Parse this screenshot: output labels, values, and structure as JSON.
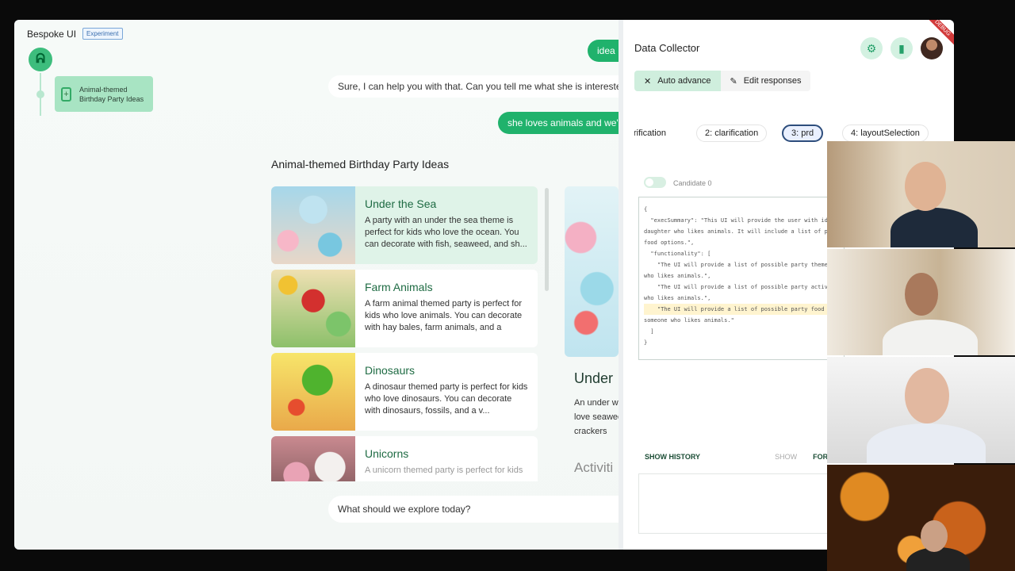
{
  "app": {
    "name": "Bespoke UI",
    "badge": "Experiment"
  },
  "sidebar": {
    "node_label": "Animal-themed Birthday Party Ideas"
  },
  "chat": {
    "user_chip_1": "idea",
    "bot_msg": "Sure, I can help you with that. Can you tell me what she is interested",
    "user_chip_2": "she loves animals and we'"
  },
  "section_title": "Animal-themed Birthday Party Ideas",
  "cards": [
    {
      "title": "Under the Sea",
      "desc": "A party with an under the sea theme is perfect for kids who love the ocean. You can decorate with fish, seaweed, and sh..."
    },
    {
      "title": "Farm Animals",
      "desc": "A farm animal themed party is perfect for kids who love animals. You can decorate with hay bales, farm animals, and a tract..."
    },
    {
      "title": "Dinosaurs",
      "desc": "A dinosaur themed party is perfect for kids who love dinosaurs. You can decorate with dinosaurs, fossils, and a v..."
    },
    {
      "title": "Unicorns",
      "desc": "A unicorn themed party is perfect for kids"
    }
  ],
  "detail": {
    "title": "Under",
    "desc": "An under who love seaweec crackers",
    "section": "Activiti"
  },
  "input": {
    "placeholder": "What should we explore today?"
  },
  "panel": {
    "title": "Data Collector",
    "debug_label": "DEBUG",
    "mode_auto": "Auto advance",
    "mode_edit": "Edit responses",
    "steps": [
      "rification",
      "2: clarification",
      "3: prd",
      "4: layoutSelection"
    ],
    "candidate": "Candidate 0",
    "code_lines": [
      "{",
      "  \"execSummary\": \"This UI will provide the user with idea",
      "daughter who likes animals. It will include a list of possib",
      "food options.\",",
      "  \"functionality\": [",
      "    \"The UI will provide a list of possible party themes tha",
      "who likes animals.\",",
      "    \"The UI will provide a list of possible party activities th",
      "who likes animals.\",",
      "    \"The UI will provide a list of possible party food option",
      "someone who likes animals.\"",
      "  ]",
      "}"
    ],
    "show_history": "SHOW HISTORY",
    "show": "SHOW",
    "format": "FORMAT"
  },
  "colors": {
    "accent": "#20b26c",
    "card_selected": "#dff3e8",
    "active_step_border": "#2d4d7c"
  },
  "icons": [
    "route-icon",
    "add-node-icon",
    "settings-icon",
    "bookmark-icon",
    "close-cross-icon",
    "pencil-icon"
  ]
}
